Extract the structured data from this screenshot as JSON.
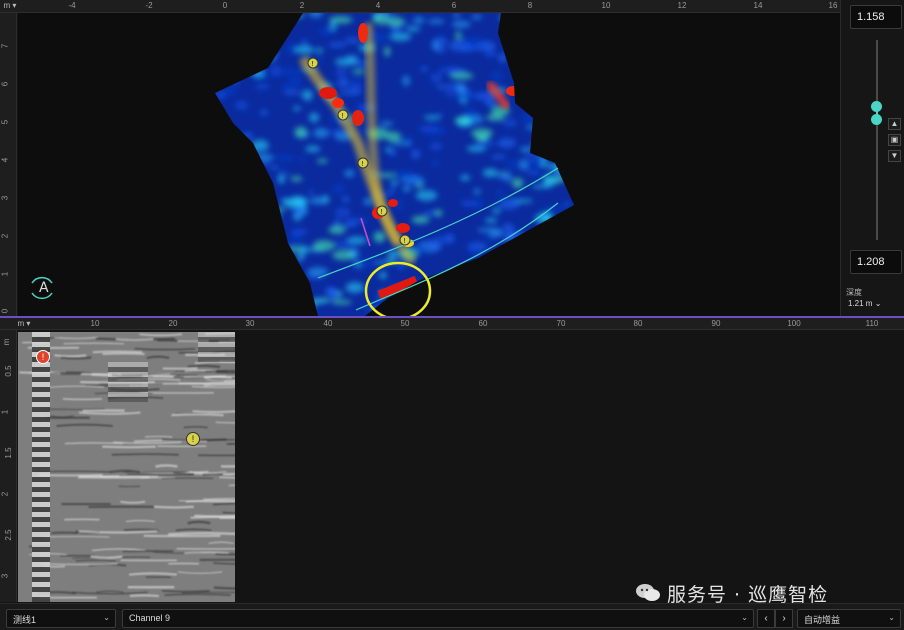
{
  "top_ruler": {
    "unit": "m",
    "ticks": [
      "-4",
      "-2",
      "0",
      "2",
      "4",
      "6",
      "8",
      "10",
      "12",
      "14",
      "16"
    ]
  },
  "left_ruler": {
    "unit": "m",
    "ticks": [
      "7",
      "6",
      "5",
      "4",
      "3",
      "2",
      "1",
      "0"
    ]
  },
  "map": {
    "north_marker": "A"
  },
  "depth_panel": {
    "top_value": "1.158",
    "bottom_value": "1.208",
    "label": "深度",
    "current": "1.21 m",
    "up_icon": "chevron-up-icon",
    "lock_icon": "lock-icon",
    "down_icon": "chevron-down-icon"
  },
  "bottom_ruler": {
    "unit": "m",
    "ticks": [
      "10",
      "20",
      "30",
      "40",
      "50",
      "60",
      "70",
      "80",
      "90",
      "100",
      "110"
    ]
  },
  "bottom_left_ruler": {
    "unit": "m",
    "ticks": [
      "0.5",
      "1",
      "1.5",
      "2",
      "2.5",
      "3"
    ]
  },
  "toolbar": {
    "line_select": "测线1",
    "channel_select": "Channel 9",
    "prev_icon": "chevron-left-icon",
    "next_icon": "chevron-right-icon",
    "gain_select": "自动增益"
  },
  "watermark": "服务号 · 巡鹰智检",
  "colors": {
    "accent": "#49d6c6",
    "divider": "#6d4fc0",
    "highlight_circle": "#ecec2a",
    "marker_red": "#e2412b",
    "marker_yellow": "#d6d24a"
  }
}
